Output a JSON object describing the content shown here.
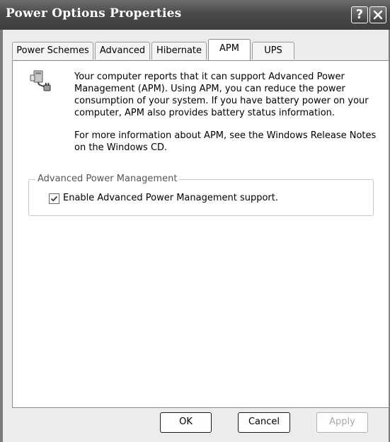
{
  "window": {
    "title": "Power Options Properties",
    "help_button": "?",
    "close_button": "✕"
  },
  "tabs": [
    {
      "label": "Power Schemes",
      "active": false
    },
    {
      "label": "Advanced",
      "active": false
    },
    {
      "label": "Hibernate",
      "active": false
    },
    {
      "label": "APM",
      "active": true
    },
    {
      "label": "UPS",
      "active": false
    }
  ],
  "apm": {
    "icon": "apm-computer-plug-icon",
    "paragraph1": "Your computer reports that it can support Advanced Power Management (APM).  Using APM, you can reduce the power consumption of your system.  If you have battery power on your computer, APM also provides battery status information.",
    "paragraph2": "For more information about APM, see the Windows Release Notes on the Windows CD.",
    "group_label": "Advanced Power Management",
    "checkbox_label": "Enable Advanced Power Management support.",
    "checkbox_checked": true
  },
  "buttons": {
    "ok": "OK",
    "cancel": "Cancel",
    "apply": "Apply"
  }
}
